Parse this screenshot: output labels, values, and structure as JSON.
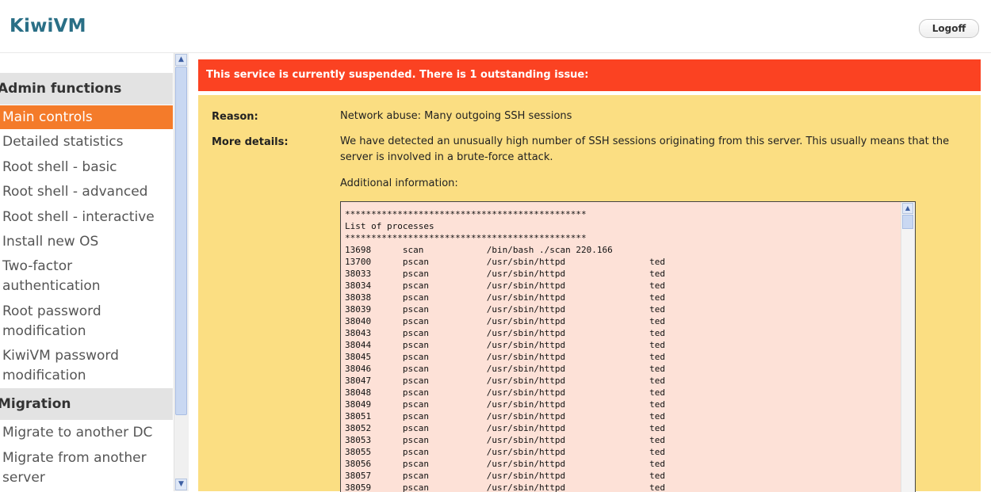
{
  "header": {
    "logo": "KiwiVM",
    "logoff_label": "Logoff"
  },
  "sidebar": {
    "sections": [
      {
        "title": "Admin functions",
        "items": [
          {
            "label": "Main controls",
            "active": true
          },
          {
            "label": "Detailed statistics"
          },
          {
            "label": "Root shell - basic"
          },
          {
            "label": "Root shell - advanced"
          },
          {
            "label": "Root shell - interactive"
          },
          {
            "label": "Install new OS"
          },
          {
            "label": "Two-factor authentication"
          },
          {
            "label": "Root password modification"
          },
          {
            "label": "KiwiVM password modification"
          }
        ]
      },
      {
        "title": "Migration",
        "items": [
          {
            "label": "Migrate to another DC"
          },
          {
            "label": "Migrate from another server"
          }
        ]
      }
    ]
  },
  "alert": {
    "text": "This service is currently suspended. There is 1 outstanding issue:"
  },
  "issue": {
    "reason_label": "Reason:",
    "reason_value": "Network abuse: Many outgoing SSH sessions",
    "details_label": "More details:",
    "details_value": "We have detected an unusually high number of SSH sessions originating from this server. This usually means that the server is involved in a brute-force attack.",
    "additional_label": "Additional information:",
    "additional_text": "**********************************************\nList of processes\n**********************************************\n13698      scan            /bin/bash ./scan 220.166\n13700      pscan           /usr/sbin/httpd                ted\n38033      pscan           /usr/sbin/httpd                ted\n38034      pscan           /usr/sbin/httpd                ted\n38038      pscan           /usr/sbin/httpd                ted\n38039      pscan           /usr/sbin/httpd                ted\n38040      pscan           /usr/sbin/httpd                ted\n38043      pscan           /usr/sbin/httpd                ted\n38044      pscan           /usr/sbin/httpd                ted\n38045      pscan           /usr/sbin/httpd                ted\n38046      pscan           /usr/sbin/httpd                ted\n38047      pscan           /usr/sbin/httpd                ted\n38048      pscan           /usr/sbin/httpd                ted\n38049      pscan           /usr/sbin/httpd                ted\n38051      pscan           /usr/sbin/httpd                ted\n38052      pscan           /usr/sbin/httpd                ted\n38053      pscan           /usr/sbin/httpd                ted\n38055      pscan           /usr/sbin/httpd                ted\n38056      pscan           /usr/sbin/httpd                ted\n38057      pscan           /usr/sbin/httpd                ted\n38059      pscan           /usr/sbin/httpd                ted"
  },
  "colors": {
    "accent": "#f47b2a",
    "alert": "#fb4222",
    "panel": "#fbde82",
    "textbox": "#fde1d7",
    "logo": "#2a6f86"
  }
}
